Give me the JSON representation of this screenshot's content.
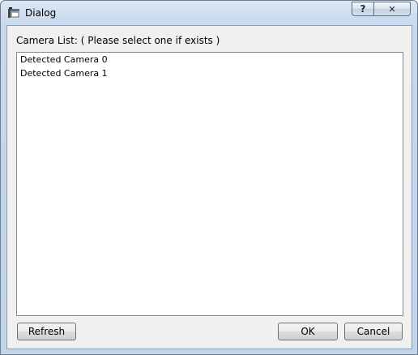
{
  "window": {
    "title": "Dialog",
    "help_label": "?",
    "close_label": "✕"
  },
  "main": {
    "list_label": "Camera List: ( Please select one if exists )",
    "cameras": [
      "Detected Camera 0",
      "Detected Camera 1"
    ]
  },
  "buttons": {
    "refresh": "Refresh",
    "ok": "OK",
    "cancel": "Cancel"
  },
  "icons": {
    "app": "app-window-icon",
    "help": "help-icon",
    "close": "close-icon"
  },
  "colors": {
    "frame": "#c2d4ea",
    "client": "#f0f0f0",
    "list_bg": "#ffffff"
  }
}
